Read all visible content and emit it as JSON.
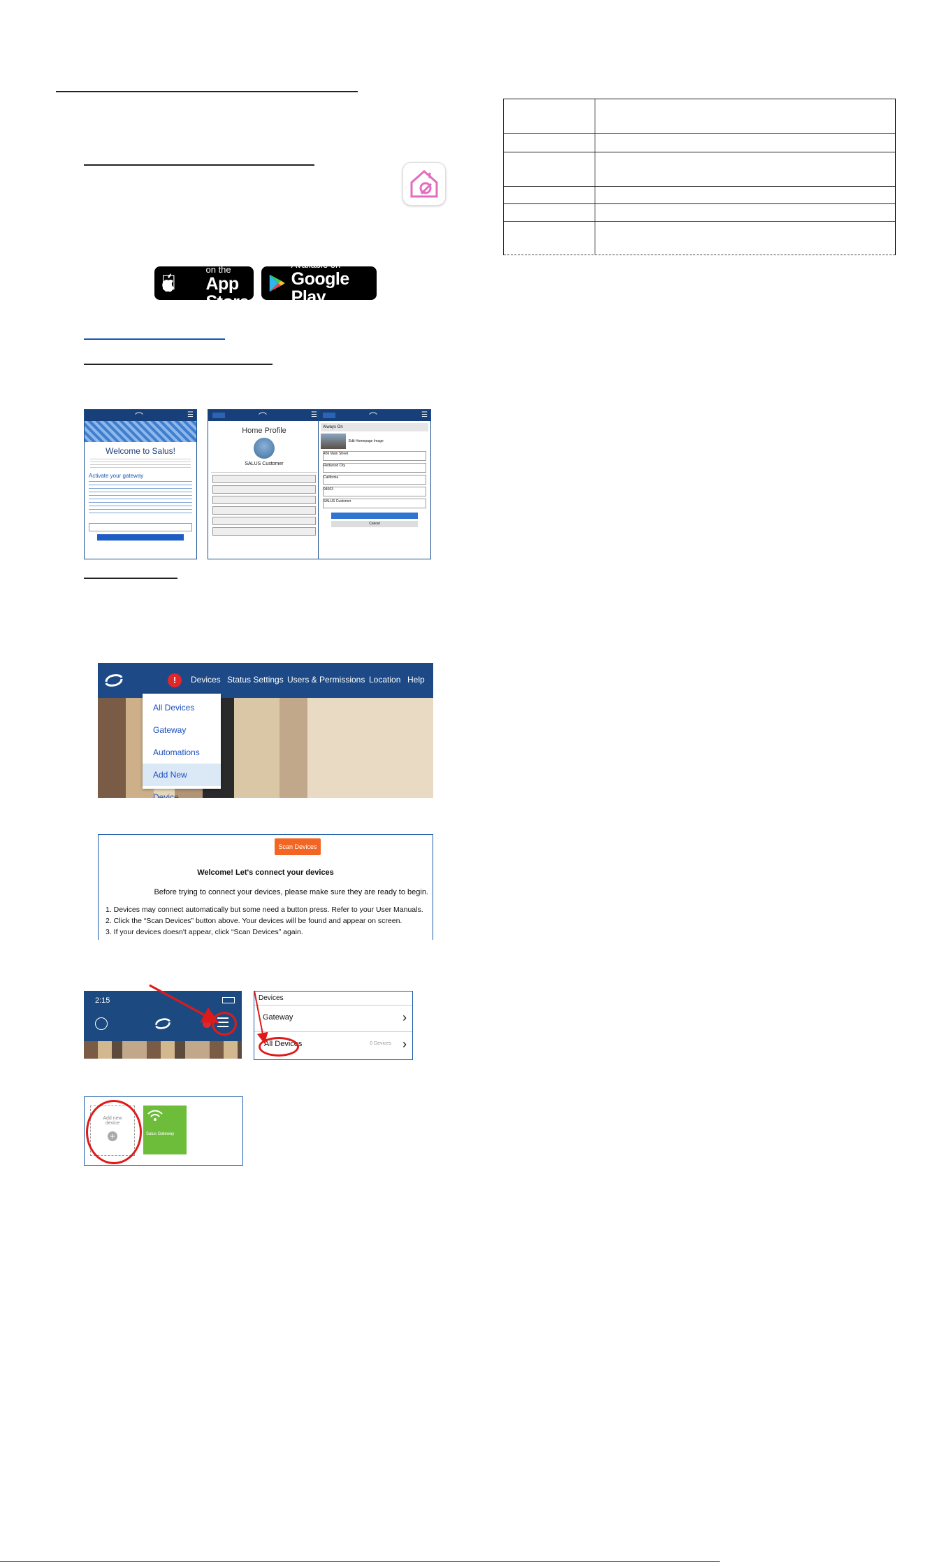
{
  "badges": {
    "appstore_small": "Available on the",
    "appstore_big": "App Store",
    "googleplay_small": "Available on",
    "googleplay_big": "Google Play"
  },
  "phone1": {
    "title": "Welcome to Salus!",
    "heading": "Activate your gateway"
  },
  "phone2": {
    "title": "Home Profile",
    "customer": "SALUS Customer"
  },
  "phone3": {
    "status": "Always On",
    "edit_label": "Edit Homepage Image",
    "address": "456 Main Street",
    "city": "Redwood City",
    "state": "California",
    "zip": "94063",
    "name": "SALUS Customer",
    "cancel": "Cancel"
  },
  "web_nav": {
    "items": [
      "Devices",
      "Status Settings",
      "Users & Permissions",
      "Location",
      "Help"
    ],
    "menu": [
      "All Devices",
      "Gateway",
      "Automations",
      "Add New Device"
    ]
  },
  "scan": {
    "button": "Scan Devices",
    "heading": "Welcome! Let's connect your devices",
    "intro": "Before trying to connect your devices, please make sure they are ready to begin.",
    "step1": "1. Devices may connect automatically but some need a button press. Refer to your User Manuals.",
    "step2": "2. Click the “Scan Devices” button above. Your devices will be found and appear on screen.",
    "step3": "3. If your devices doesn't appear, click “Scan Devices” again."
  },
  "mobile_header": {
    "time": "2:15"
  },
  "devices_panel": {
    "title": "Devices",
    "row1": "Gateway",
    "row2": "All Devices",
    "row2_count": "0 Devices"
  },
  "tiles": {
    "add_label": "Add new device",
    "gateway_label": "Salus Gateway"
  }
}
